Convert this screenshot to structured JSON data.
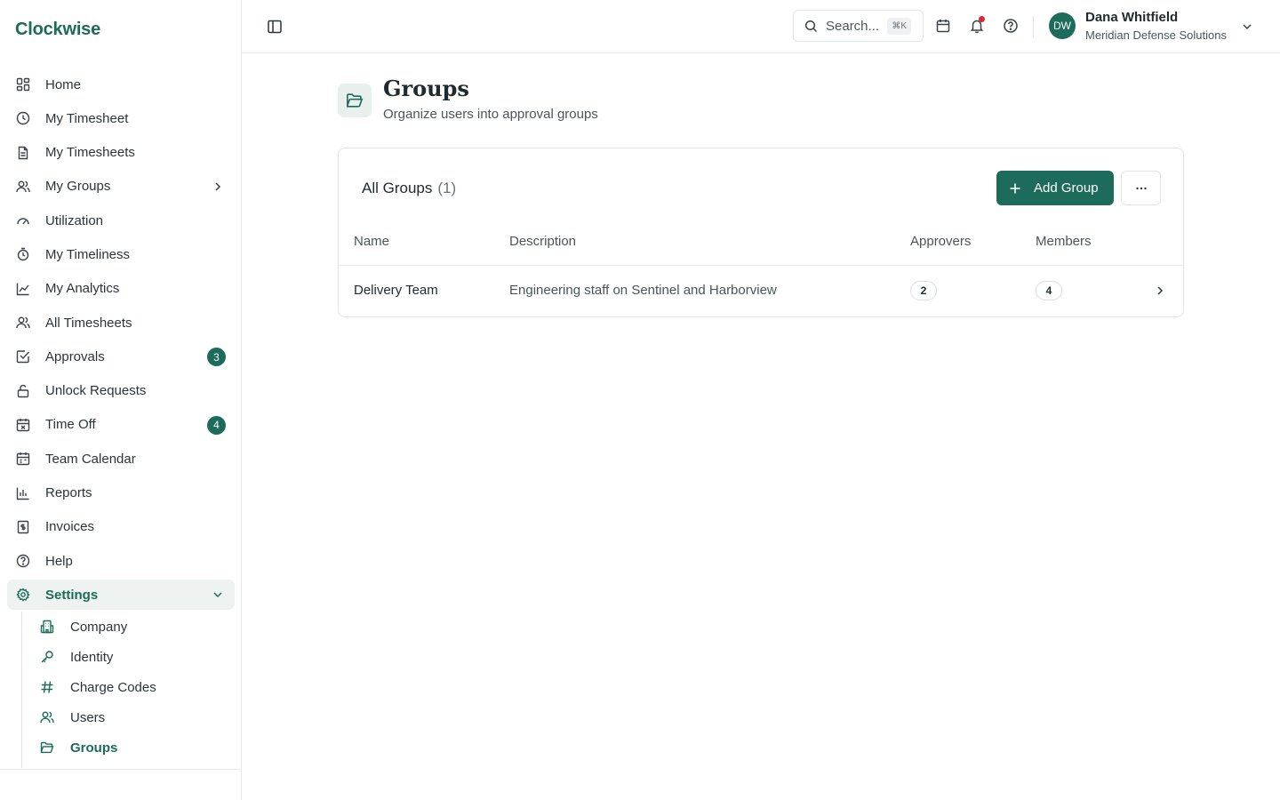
{
  "app": {
    "name": "Clockwise"
  },
  "sidebar": {
    "items": [
      {
        "label": "Home",
        "icon": "dashboard-icon"
      },
      {
        "label": "My Timesheet",
        "icon": "clock-icon"
      },
      {
        "label": "My Timesheets",
        "icon": "document-icon"
      },
      {
        "label": "My Groups",
        "icon": "users-icon"
      },
      {
        "label": "Utilization",
        "icon": "gauge-icon"
      },
      {
        "label": "My Timeliness",
        "icon": "stopwatch-icon"
      },
      {
        "label": "My Analytics",
        "icon": "line-chart-icon"
      },
      {
        "label": "All Timesheets",
        "icon": "users-icon"
      },
      {
        "label": "Approvals",
        "icon": "check-square-icon",
        "badge": "3"
      },
      {
        "label": "Unlock Requests",
        "icon": "unlock-icon"
      },
      {
        "label": "Time Off",
        "icon": "calendar-x-icon",
        "badge": "4"
      },
      {
        "label": "Team Calendar",
        "icon": "calendar-icon"
      },
      {
        "label": "Reports",
        "icon": "bar-chart-icon"
      },
      {
        "label": "Invoices",
        "icon": "invoice-icon"
      },
      {
        "label": "Help",
        "icon": "help-icon"
      },
      {
        "label": "Settings",
        "icon": "gear-icon"
      }
    ],
    "settings_sub": [
      {
        "label": "Company",
        "icon": "building-icon"
      },
      {
        "label": "Identity",
        "icon": "key-icon"
      },
      {
        "label": "Charge Codes",
        "icon": "hash-icon"
      },
      {
        "label": "Users",
        "icon": "users-icon"
      },
      {
        "label": "Groups",
        "icon": "folder-open-icon"
      }
    ]
  },
  "topbar": {
    "search_placeholder": "Search...",
    "search_shortcut": "⌘K",
    "user": {
      "initials": "DW",
      "name": "Dana Whitfield",
      "org": "Meridian Defense Solutions"
    }
  },
  "page": {
    "title": "Groups",
    "subtitle": "Organize users into approval groups"
  },
  "groups_card": {
    "title": "All Groups",
    "count": "(1)",
    "add_label": "Add Group",
    "columns": [
      "Name",
      "Description",
      "Approvers",
      "Members"
    ],
    "rows": [
      {
        "name": "Delivery Team",
        "description": "Engineering staff on Sentinel and Harborview",
        "approvers": "2",
        "members": "4"
      }
    ]
  },
  "colors": {
    "accent": "#1d6b5a",
    "notification": "#e0233a",
    "active_bg": "#eef2f0"
  }
}
